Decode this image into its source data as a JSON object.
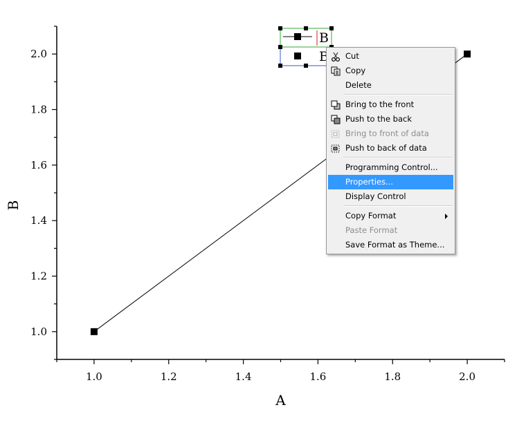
{
  "chart_data": {
    "type": "line",
    "title": "",
    "xlabel": "A",
    "ylabel": "B",
    "xlim": [
      0.9,
      2.1
    ],
    "ylim": [
      0.9,
      2.1
    ],
    "x_ticks": [
      "1.0",
      "1.2",
      "1.4",
      "1.6",
      "1.8",
      "2.0"
    ],
    "y_ticks": [
      "1.0",
      "1.2",
      "1.4",
      "1.6",
      "1.8",
      "2.0"
    ],
    "series": [
      {
        "x": [
          1.0,
          2.0
        ],
        "y": [
          1.0,
          2.0
        ],
        "marker": "square",
        "color": "#000000"
      }
    ],
    "legend": {
      "entries": [
        "B"
      ],
      "placement": "top-center"
    },
    "grid": false
  },
  "context_menu": {
    "items": [
      {
        "label": "Cut",
        "icon": "scissors-icon",
        "enabled": true
      },
      {
        "label": "Copy",
        "icon": "copy-icon",
        "enabled": true
      },
      {
        "label": "Delete",
        "icon": "",
        "enabled": true
      },
      {
        "separator": true
      },
      {
        "label": "Bring to the front",
        "icon": "bring-front-icon",
        "enabled": true
      },
      {
        "label": "Push to the back",
        "icon": "push-back-icon",
        "enabled": true
      },
      {
        "label": "Bring to front of data",
        "icon": "bring-front-data-icon",
        "enabled": false
      },
      {
        "label": "Push to back of data",
        "icon": "push-back-data-icon",
        "enabled": true
      },
      {
        "separator": true
      },
      {
        "label": "Programming Control...",
        "icon": "",
        "enabled": true
      },
      {
        "label": "Properties...",
        "icon": "",
        "enabled": true,
        "highlighted": true
      },
      {
        "label": "Display Control",
        "icon": "",
        "enabled": true
      },
      {
        "separator": true
      },
      {
        "label": "Copy Format",
        "icon": "",
        "enabled": true,
        "submenu": true
      },
      {
        "label": "Paste Format",
        "icon": "",
        "enabled": false
      },
      {
        "label": "Save Format as Theme...",
        "icon": "",
        "enabled": true
      }
    ],
    "highlight_color": "#3399ff"
  }
}
